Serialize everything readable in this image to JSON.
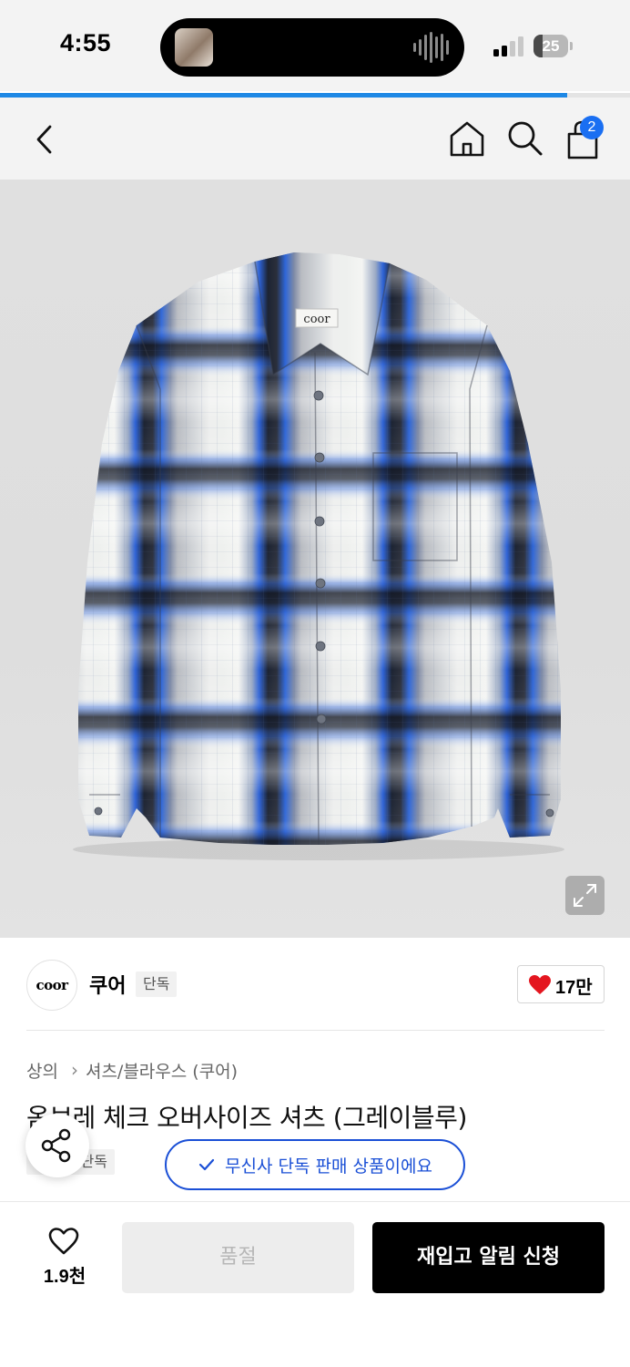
{
  "status_bar": {
    "time": "4:55",
    "battery_level": "25",
    "battery_fraction": 0.25,
    "signal_bars_active": 2,
    "signal_bars_total": 4
  },
  "page_load_progress": 0.9,
  "nav": {
    "back_icon": "chevron-left-icon",
    "home_icon": "home-icon",
    "search_icon": "search-icon",
    "cart_icon": "shopping-bag-icon",
    "cart_count": "2"
  },
  "product_image": {
    "label_text": "coor"
  },
  "brand": {
    "logo_text": "coor",
    "name": "쿠어",
    "tag": "단독",
    "likes": "17만"
  },
  "breadcrumb": {
    "category": "상의",
    "subcategory": "셔츠/블라우스 (쿠어)"
  },
  "product": {
    "title": "옴브레 체크 오버사이즈 셔츠 (그레이블루)",
    "exclusive_tag": "단독",
    "exclusive_pill_label": "무신사 단독 판매 상품이에요"
  },
  "bottom": {
    "wish_count": "1.9천",
    "soldout_label": "품절",
    "restock_label": "재입고 알림 신청"
  },
  "colors": {
    "accent_blue": "#1a4fd6",
    "badge_blue": "#1a6ff2",
    "like_red": "#e4161f",
    "primary_black": "#000000"
  }
}
